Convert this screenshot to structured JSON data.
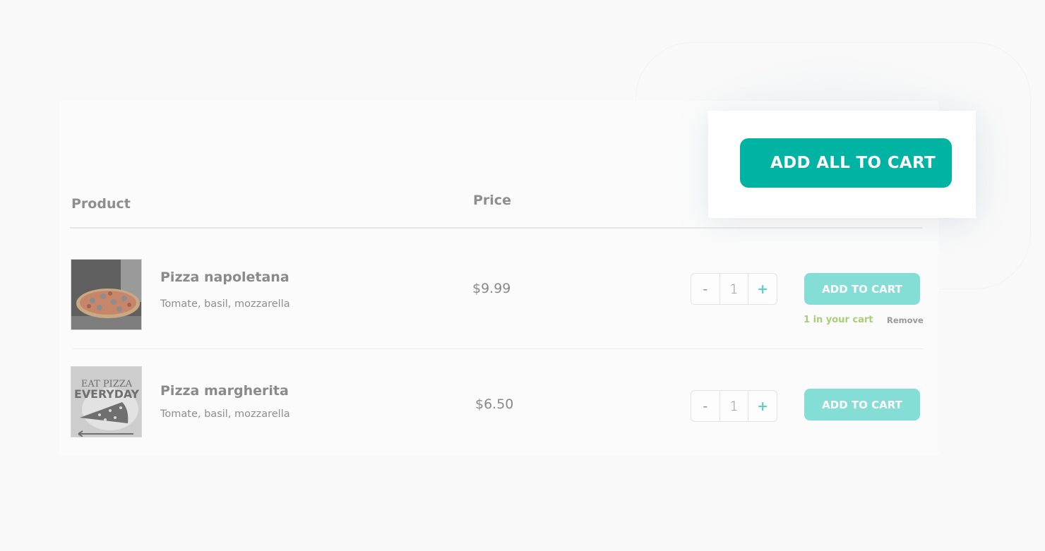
{
  "bulk_action": {
    "add_all_label": "ADD ALL TO CART"
  },
  "table": {
    "headers": {
      "product": "Product",
      "price": "Price"
    },
    "rows": [
      {
        "name": "Pizza napoletana",
        "description": "Tomate, basil, mozzarella",
        "price": "$9.99",
        "quantity": "1",
        "decrement_label": "-",
        "increment_label": "+",
        "add_label": "ADD TO CART",
        "cart_status": "1 in your cart",
        "remove_label": "Remove",
        "image": "pizza-photo"
      },
      {
        "name": "Pizza margherita",
        "description": "Tomate, basil, mozzarella",
        "price": "$6.50",
        "quantity": "1",
        "decrement_label": "-",
        "increment_label": "+",
        "add_label": "ADD TO CART",
        "image": "eat-pizza-everyday-poster",
        "image_text": [
          "EAT PIZZA",
          "EVERYDAY"
        ]
      }
    ]
  },
  "colors": {
    "primary": "#00b3a3",
    "primary_light": "#84ded6",
    "in_cart": "#a8cf75",
    "text": "#8a8a8a"
  }
}
